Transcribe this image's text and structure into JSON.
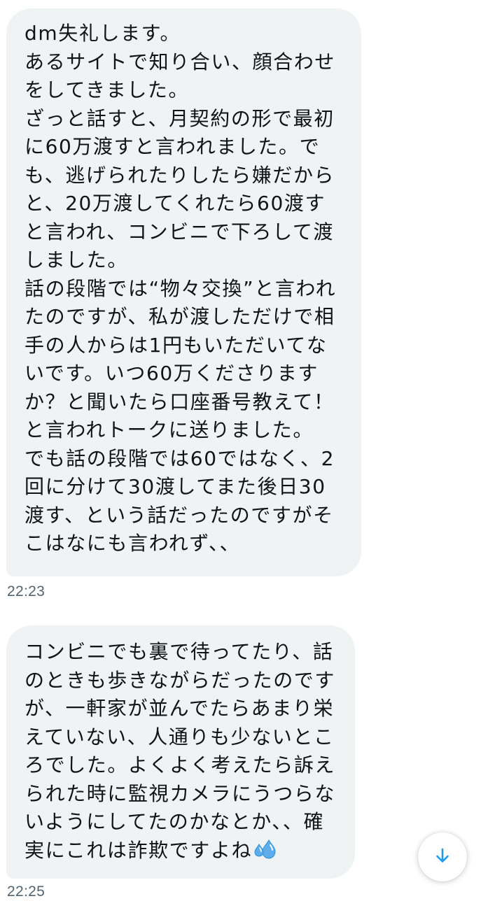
{
  "messages": [
    {
      "lines": [
        "dm失礼します。",
        "あるサイトで知り合い、顔合わせ",
        "をしてきました。",
        "ざっと話すと、月契約の形で最初",
        "に60万渡すと言われました。で",
        "も、逃げられたりしたら嫌だから",
        "と、20万渡してくれたら60渡す",
        "と言われ、コンビニで下ろして渡",
        "しました。",
        "話の段階では“物々交換”と言われ",
        "たのですが、私が渡しただけで相",
        "手の人からは1円もいただいてな",
        "いです。いつ60万くださります",
        "か？と聞いたら口座番号教えて！",
        "と言われトークに送りました。",
        "でも話の段階では60ではなく、2",
        "回に分けて30渡してまた後日30",
        "渡す、という話だったのですがそ",
        "こはなにも言われず、、"
      ],
      "time": "22:23"
    },
    {
      "lines": [
        "コンビニでも裏で待ってたり、話",
        "のときも歩きながらだったのです",
        "が、一軒家が並んでたらあまり栄",
        "えていない、人通りも少ないとこ",
        "ろでした。よくよく考えたら訴え",
        "られた時に監視カメラにうつらな",
        "いようにしてたのかなとか、、確",
        "実にこれは詐欺ですよね"
      ],
      "emoji": "sweat-droplets-icon",
      "time": "22:25"
    }
  ],
  "scroll_button": {
    "icon": "arrow-down-icon"
  },
  "colors": {
    "bubble_bg": "#eff3f4",
    "text": "#0f1419",
    "timestamp": "#536471",
    "accent": "#1d9bf0"
  }
}
